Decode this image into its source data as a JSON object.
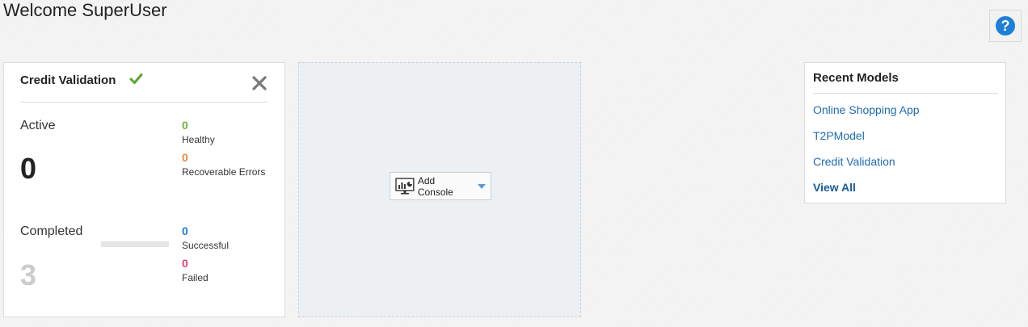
{
  "header": {
    "welcome": "Welcome SuperUser",
    "help_symbol": "?"
  },
  "card": {
    "title": "Credit Validation",
    "active": {
      "label": "Active",
      "total": "0",
      "healthy_count": "0",
      "healthy_label": "Healthy",
      "recoverable_count": "0",
      "recoverable_label": "Recoverable Errors"
    },
    "completed": {
      "label": "Completed",
      "total": "3",
      "progress_fraction": 0,
      "successful_count": "0",
      "successful_label": "Successful",
      "failed_count": "0",
      "failed_label": "Failed"
    }
  },
  "dropzone": {
    "add_console_label": "Add Console"
  },
  "recent_models": {
    "title": "Recent Models",
    "items": [
      "Online Shopping App",
      "T2PModel",
      "Credit Validation"
    ],
    "view_all": "View All"
  },
  "colors": {
    "healthy": "#6cb33f",
    "recoverable": "#e88a3a",
    "successful": "#1f7bc1",
    "failed": "#e0407a",
    "check": "#5aa62f",
    "link": "#1f6bb0",
    "help": "#1e7fd6"
  },
  "icons": {
    "help": "help-icon",
    "check": "check-icon",
    "close": "close-icon",
    "console": "console-chart-icon",
    "dropdown": "caret-down-icon"
  }
}
